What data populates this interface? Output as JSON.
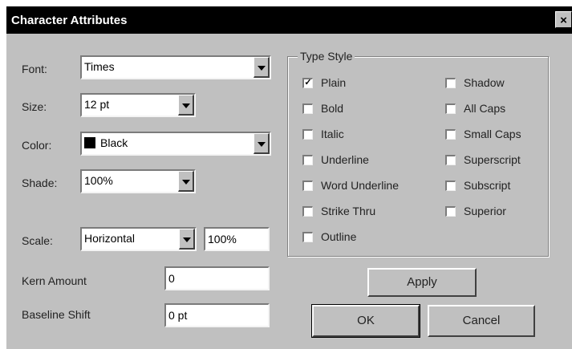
{
  "window": {
    "title": "Character Attributes",
    "close_glyph": "×"
  },
  "labels": {
    "font": "Font:",
    "size": "Size:",
    "color": "Color:",
    "shade": "Shade:",
    "scale": "Scale:",
    "kern_amount": "Kern Amount",
    "baseline_shift": "Baseline Shift"
  },
  "fields": {
    "font": "Times",
    "size": "12 pt",
    "color": "Black",
    "shade": "100%",
    "scale_direction": "Horizontal",
    "scale_value": "100%",
    "kern_amount": "0",
    "baseline_shift": "0 pt"
  },
  "type_style": {
    "legend": "Type Style",
    "left_options": [
      {
        "label": "Plain",
        "checked": true
      },
      {
        "label": "Bold",
        "checked": false
      },
      {
        "label": "Italic",
        "checked": false
      },
      {
        "label": "Underline",
        "checked": false
      },
      {
        "label": "Word Underline",
        "checked": false
      },
      {
        "label": "Strike Thru",
        "checked": false
      },
      {
        "label": "Outline",
        "checked": false
      }
    ],
    "right_options": [
      {
        "label": "Shadow",
        "checked": false
      },
      {
        "label": "All Caps",
        "checked": false
      },
      {
        "label": "Small Caps",
        "checked": false
      },
      {
        "label": "Superscript",
        "checked": false
      },
      {
        "label": "Subscript",
        "checked": false
      },
      {
        "label": "Superior",
        "checked": false
      }
    ]
  },
  "buttons": {
    "apply": "Apply",
    "ok": "OK",
    "cancel": "Cancel"
  },
  "colors": {
    "dialog_bg": "#c0c0c0",
    "titlebar_bg": "#000000",
    "selected_color_swatch": "#000000"
  }
}
